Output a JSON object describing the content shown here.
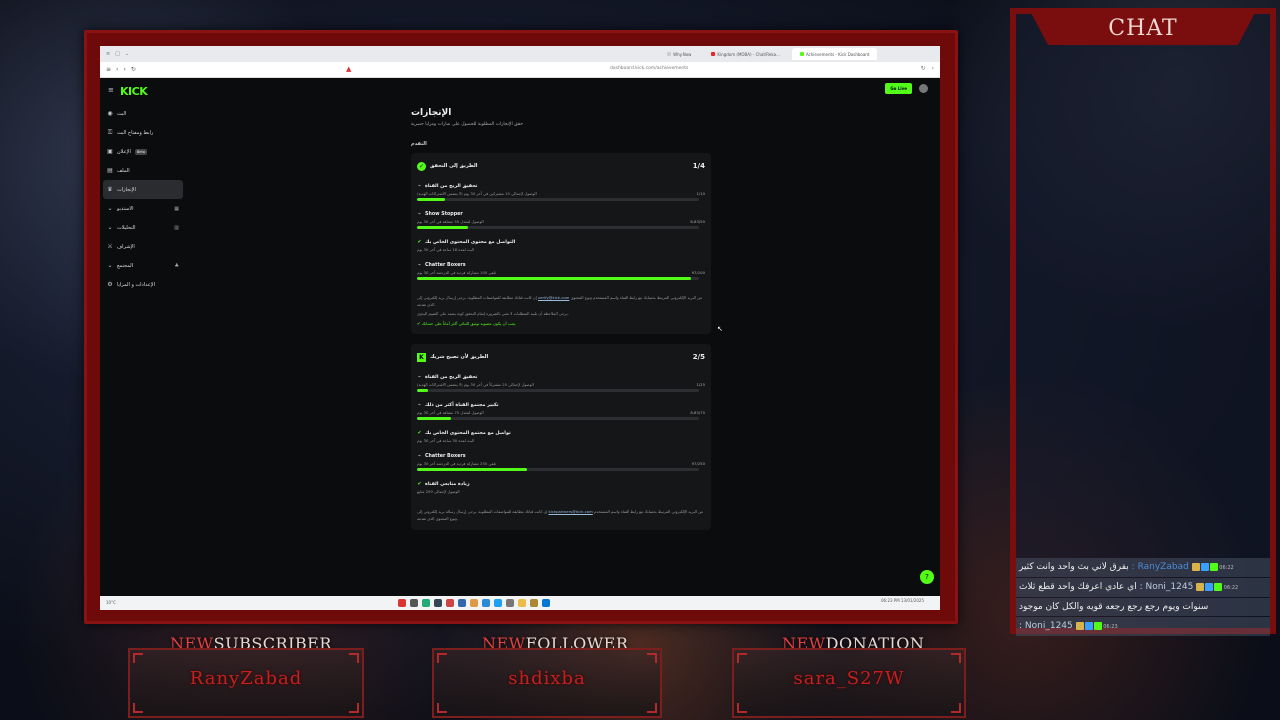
{
  "chat": {
    "title": "CHAT",
    "messages": [
      {
        "time": "06:22",
        "user": "RanyZabad",
        "text": "بفرق لاني بث واحد وانت كثير"
      },
      {
        "time": "06:22",
        "user": "Noni_1245",
        "text": "اي عادي اعرفك واحد قطع ثلاث"
      },
      {
        "time": "",
        "user": "",
        "text": "سنوات ويوم رجع رجع رجعه قويه والكل كان موجود"
      },
      {
        "time": "06:23",
        "user": "Noni_1245",
        "text": ""
      }
    ]
  },
  "alerts": [
    {
      "prefix": "NEW",
      "label": "SUBSCRIBER",
      "name": "RanyZabad"
    },
    {
      "prefix": "NEW",
      "label": "FOLLOWER",
      "name": "shdixba"
    },
    {
      "prefix": "NEW",
      "label": "DONATION",
      "name": "sara_S27W"
    }
  ],
  "browser": {
    "url": "dashboard.kick.com/achievements",
    "tabs": [
      "Why.Now",
      "Kingdom (MOBA) - Chat/Reka...",
      "Achievements - Kick Dashboard"
    ]
  },
  "kick": {
    "logo": "KICK",
    "go_live": "Go Live",
    "sidebar": [
      {
        "label": "البث",
        "icon": "broadcast-icon"
      },
      {
        "label": "رابط ومفتاح البث",
        "icon": "key-icon"
      },
      {
        "label": "الإعلان",
        "icon": "ad-icon",
        "badge": "Beta"
      },
      {
        "label": "الملف",
        "icon": "file-icon"
      },
      {
        "label": "الإنجازات",
        "icon": "trophy-icon",
        "active": true
      },
      {
        "label": "الاستديو",
        "icon": "studio-icon",
        "expandable": true
      },
      {
        "label": "التحليلات",
        "icon": "analytics-icon",
        "expandable": true
      },
      {
        "label": "الإشراف",
        "icon": "moderation-icon"
      },
      {
        "label": "المجتمع",
        "icon": "community-icon",
        "expandable": true
      },
      {
        "label": "الإعدادات و المزايا",
        "icon": "settings-icon"
      }
    ],
    "page": {
      "title": "الإنجازات",
      "subtitle": "حقق الإنجازات المطلوبة للحصول على شارات ومزايا حصرية",
      "section": "التقدم"
    },
    "cards": [
      {
        "title": "الطريق إلى التحقق",
        "count": "1/4",
        "goals": [
          {
            "title": "تحقيق الربح من القناة",
            "desc": "الوصول لإجمالي 10 مشتركين في آخر 30 يوم (لا يتضمن الاشتراكات الهدية)",
            "progress": "1/10",
            "fraction": 0.1
          },
          {
            "title": "Show Stopper",
            "desc": "الوصول لمعدل 50 مشاهد في آخر 30 يوم",
            "progress": "8.83/50",
            "fraction": 0.18
          },
          {
            "title": "التواصل مع محتوى المحتوى الخاص بك",
            "desc": "البث لمدة 18 ساعة في آخر 30 يوم",
            "progress": "",
            "fraction": null,
            "done": true
          },
          {
            "title": "Chatter Boxers",
            "desc": "تلقي 100 مشاركة فردية في الدردشة آخر 30 يوم",
            "progress": "97/100",
            "fraction": 0.97
          }
        ],
        "note": "إن كانت قناتك مطابقة للمواصفات المطلوبة، يرجى إرسال بريد إلكتروني إلى verify@kick.com من البريد الإلكتروني المرتبط بحسابك مع رابط القناة واسم المستخدم ونوع المحتوى الذي تقدمه.",
        "note_link": "verify@kick.com",
        "note2": "يرجى الملاحظة أن تلبية المتطلبات لا تعني بالضرورة إتمام التحقق كونه يعتمد على التقييم اليدوي.",
        "note_green": "يجب أن يكون عضوية توثيق الثنائي أكثر أماناً على حسابك"
      },
      {
        "title": "الطريق لأن تصبح شريك",
        "count": "2/5",
        "goals": [
          {
            "title": "تحقيق الربح من القناة",
            "desc": "الوصول لإجمالي 25 مشتركاً في آخر 30 يوم (لا يتضمن الاشتراكات الهدية)",
            "progress": "1/25",
            "fraction": 0.04
          },
          {
            "title": "تكبير مجتمع القناة أكثر من ذلك",
            "desc": "الوصول لمعدل 75 مشاهد في آخر 30 يوم",
            "progress": "8.83/75",
            "fraction": 0.12
          },
          {
            "title": "تواصل مع مجتمع المحتوى الخاص بك",
            "desc": "البث لمدة 30 ساعة في آخر 30 يوم",
            "progress": "",
            "fraction": null,
            "done": true
          },
          {
            "title": "Chatter Boxers",
            "desc": "تلقي 250 مشاركة فردية في الدردشة آخر 30 يوم",
            "progress": "97/250",
            "fraction": 0.39
          },
          {
            "title": "زيادة متابعي القناة",
            "desc": "الوصول لإجمالي 250 متابع",
            "progress": "",
            "fraction": null,
            "done": true
          }
        ],
        "note": "إن كانت قناتك مطابقة للمواصفات المطلوبة، يرجى إرسال رسالة بريد إلكتروني إلى kickpartners@kick.com من البريد الإلكتروني المرتبط بحسابك مع رابط القناة واسم المستخدم ونوع المحتوى الذي تقدمه.",
        "note_link": "kickpartners@kick.com"
      }
    ]
  },
  "taskbar": {
    "left": "10°C",
    "right": "06:23 PM\n13/01/2025"
  },
  "colors": {
    "kick_green": "#53fc18",
    "frame_red": "#7a0d0d",
    "alert_name": "#c42020"
  }
}
